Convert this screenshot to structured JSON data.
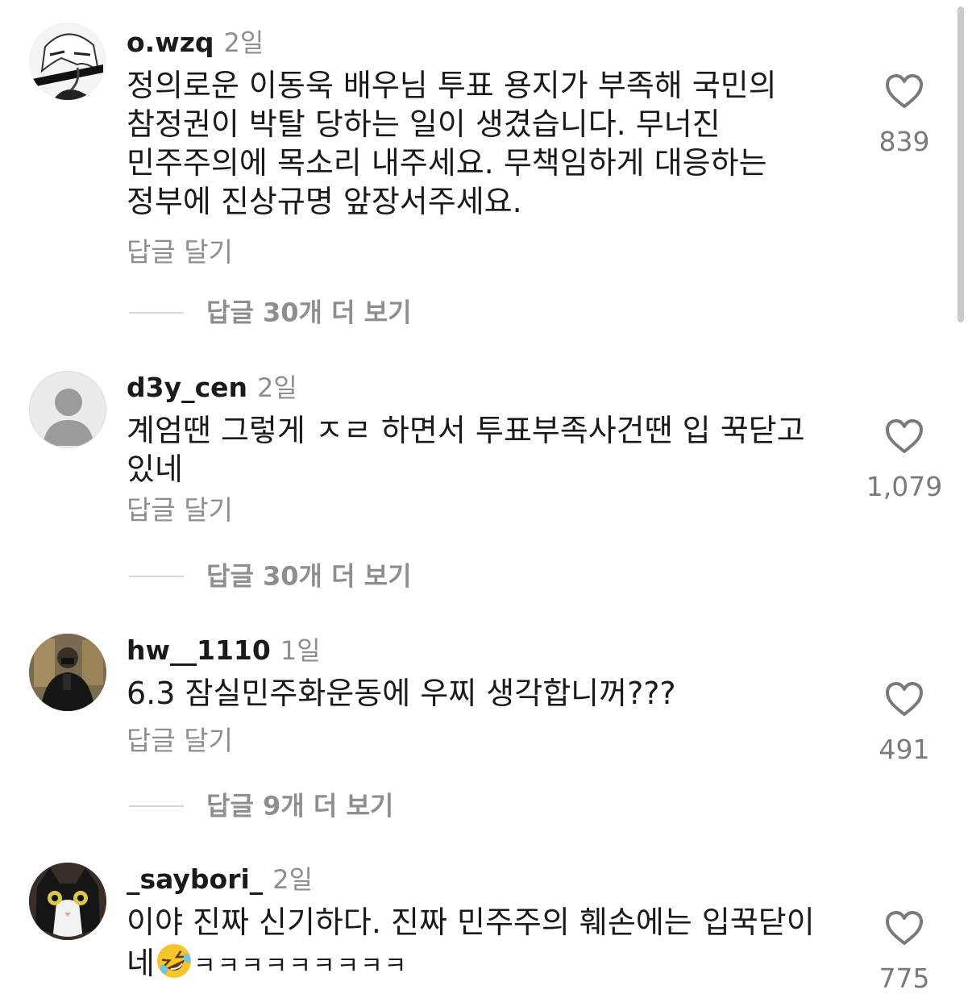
{
  "comments": [
    {
      "username": "o.wzq",
      "time": "2일",
      "text": "정의로운 이동욱 배우님 투표 용지가 부족해 국민의 참정권이 박탈 당하는 일이 생겼습니다. 무너진 민주주의에 목소리 내주세요. 무책임하게 대응하는 정부에 진상규명 앞장서주세요.",
      "reply_label": "답글 달기",
      "view_replies": "답글 30개 더 보기",
      "likes": "839",
      "avatar": "anime-character-avatar"
    },
    {
      "username": "d3y_cen",
      "time": "2일",
      "text": "계엄땐 그렇게 ㅈㄹ 하면서 투표부족사건땐 입 꾹닫고 있네",
      "reply_label": "답글 달기",
      "view_replies": "답글 30개 더 보기",
      "likes": "1,079",
      "avatar": "default-user-avatar"
    },
    {
      "username": "hw__1110",
      "time": "1일",
      "text": "6.3 잠실민주화운동에 우찌 생각합니꺼???",
      "reply_label": "답글 달기",
      "view_replies": "답글 9개 더 보기",
      "likes": "491",
      "avatar": "mirror-selfie-avatar"
    },
    {
      "username": "_saybori_",
      "time": "2일",
      "text_before_emoji": "이야 진짜 신기하다. 진짜 민주주의 훼손에는 입꾹닫이 네",
      "emoji": "rolling-on-floor-laughing-emoji",
      "text_after_emoji": "ㅋㅋㅋㅋㅋㅋㅋㅋㅋ",
      "likes": "775",
      "avatar": "cat-avatar"
    }
  ],
  "colors": {
    "text": "#1a1a1a",
    "muted": "#8e8e8e",
    "divider": "#d6d6d6"
  }
}
